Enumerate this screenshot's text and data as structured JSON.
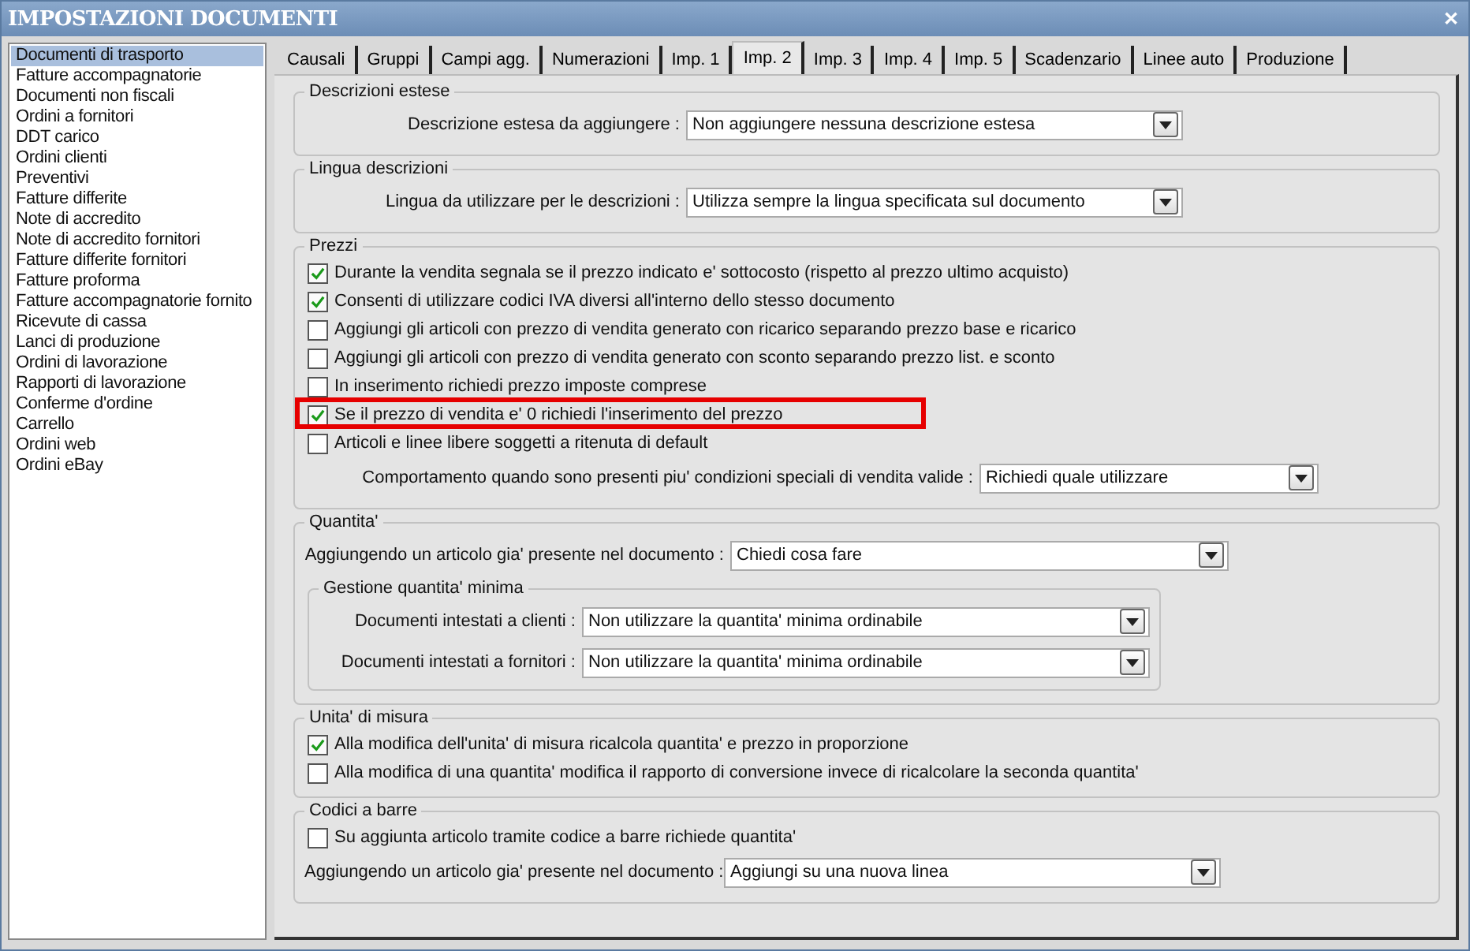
{
  "window": {
    "title": "IMPOSTAZIONI DOCUMENTI",
    "close": "✕"
  },
  "sidebar": {
    "items": [
      {
        "label": "Documenti di trasporto",
        "selected": true
      },
      {
        "label": "Fatture accompagnatorie",
        "selected": false
      },
      {
        "label": "Documenti non fiscali",
        "selected": false
      },
      {
        "label": "Ordini a fornitori",
        "selected": false
      },
      {
        "label": "DDT carico",
        "selected": false
      },
      {
        "label": "Ordini clienti",
        "selected": false
      },
      {
        "label": "Preventivi",
        "selected": false
      },
      {
        "label": "Fatture differite",
        "selected": false
      },
      {
        "label": "Note di accredito",
        "selected": false
      },
      {
        "label": "Note di accredito fornitori",
        "selected": false
      },
      {
        "label": "Fatture differite fornitori",
        "selected": false
      },
      {
        "label": "Fatture proforma",
        "selected": false
      },
      {
        "label": "Fatture accompagnatorie fornito",
        "selected": false
      },
      {
        "label": "Ricevute di cassa",
        "selected": false
      },
      {
        "label": "Lanci di produzione",
        "selected": false
      },
      {
        "label": "Ordini di lavorazione",
        "selected": false
      },
      {
        "label": "Rapporti di lavorazione",
        "selected": false
      },
      {
        "label": "Conferme d'ordine",
        "selected": false
      },
      {
        "label": "Carrello",
        "selected": false
      },
      {
        "label": "Ordini web",
        "selected": false
      },
      {
        "label": "Ordini eBay",
        "selected": false
      }
    ]
  },
  "tabs": [
    {
      "label": "Causali",
      "selected": false
    },
    {
      "label": "Gruppi",
      "selected": false
    },
    {
      "label": "Campi agg.",
      "selected": false
    },
    {
      "label": "Numerazioni",
      "selected": false
    },
    {
      "label": "Imp. 1",
      "selected": false
    },
    {
      "label": "Imp. 2",
      "selected": true
    },
    {
      "label": "Imp. 3",
      "selected": false
    },
    {
      "label": "Imp. 4",
      "selected": false
    },
    {
      "label": "Imp. 5",
      "selected": false
    },
    {
      "label": "Scadenzario",
      "selected": false
    },
    {
      "label": "Linee auto",
      "selected": false
    },
    {
      "label": "Produzione",
      "selected": false
    }
  ],
  "sections": [
    {
      "title": "Descrizioni estese",
      "rows": [
        {
          "kind": "select",
          "label": "Descrizione estesa da aggiungere :",
          "value": "Non aggiungere nessuna descrizione estesa"
        }
      ]
    },
    {
      "title": "Lingua descrizioni",
      "rows": [
        {
          "kind": "select",
          "label": "Lingua da utilizzare per le descrizioni :",
          "value": "Utilizza sempre la lingua specificata sul documento"
        }
      ]
    },
    {
      "title": "Prezzi",
      "rows": [
        {
          "kind": "checkbox",
          "label": "Durante la vendita segnala se il prezzo indicato e' sottocosto (rispetto al prezzo ultimo acquisto)",
          "checked": true,
          "highlighted": false
        },
        {
          "kind": "checkbox",
          "label": "Consenti di utilizzare codici IVA diversi all'interno dello stesso documento",
          "checked": true,
          "highlighted": false
        },
        {
          "kind": "checkbox",
          "label": "Aggiungi gli articoli con prezzo di vendita generato con ricarico separando prezzo base e ricarico",
          "checked": false,
          "highlighted": false
        },
        {
          "kind": "checkbox",
          "label": "Aggiungi gli articoli con prezzo di vendita generato con sconto separando prezzo list. e sconto",
          "checked": false,
          "highlighted": false
        },
        {
          "kind": "checkbox",
          "label": "In inserimento richiedi prezzo imposte comprese",
          "checked": false,
          "highlighted": false
        },
        {
          "kind": "checkbox",
          "label": "Se il prezzo di vendita e' 0 richiedi l'inserimento del prezzo",
          "checked": true,
          "highlighted": true
        },
        {
          "kind": "checkbox",
          "label": "Articoli e linee libere soggetti a ritenuta di default",
          "checked": false,
          "highlighted": false
        },
        {
          "kind": "select",
          "label": "Comportamento quando sono presenti piu' condizioni speciali di vendita valide :",
          "value": "Richiedi quale utilizzare"
        }
      ]
    },
    {
      "title": "Quantita'",
      "rows": [
        {
          "kind": "select",
          "label": "Aggiungendo un articolo gia' presente nel documento :",
          "value": "Chiedi cosa fare"
        },
        {
          "kind": "group",
          "title": "Gestione quantita' minima",
          "rows": [
            {
              "kind": "select",
              "label": "Documenti intestati a clienti :",
              "value": "Non utilizzare la quantita' minima ordinabile"
            },
            {
              "kind": "select",
              "label": "Documenti intestati a fornitori :",
              "value": "Non utilizzare la quantita' minima ordinabile"
            }
          ]
        }
      ]
    },
    {
      "title": "Unita' di misura",
      "rows": [
        {
          "kind": "checkbox",
          "label": "Alla modifica dell'unita' di misura ricalcola quantita' e prezzo in proporzione",
          "checked": true,
          "highlighted": false
        },
        {
          "kind": "checkbox",
          "label": "Alla modifica di una quantita' modifica il rapporto di conversione invece di ricalcolare la seconda quantita'",
          "checked": false,
          "highlighted": false
        }
      ]
    },
    {
      "title": "Codici a barre",
      "rows": [
        {
          "kind": "checkbox",
          "label": "Su aggiunta articolo tramite codice a barre richiede quantita'",
          "checked": false,
          "highlighted": false
        },
        {
          "kind": "select",
          "label": "Aggiungendo un articolo gia' presente nel documento :",
          "value": "Aggiungi su una nuova linea"
        }
      ]
    }
  ]
}
